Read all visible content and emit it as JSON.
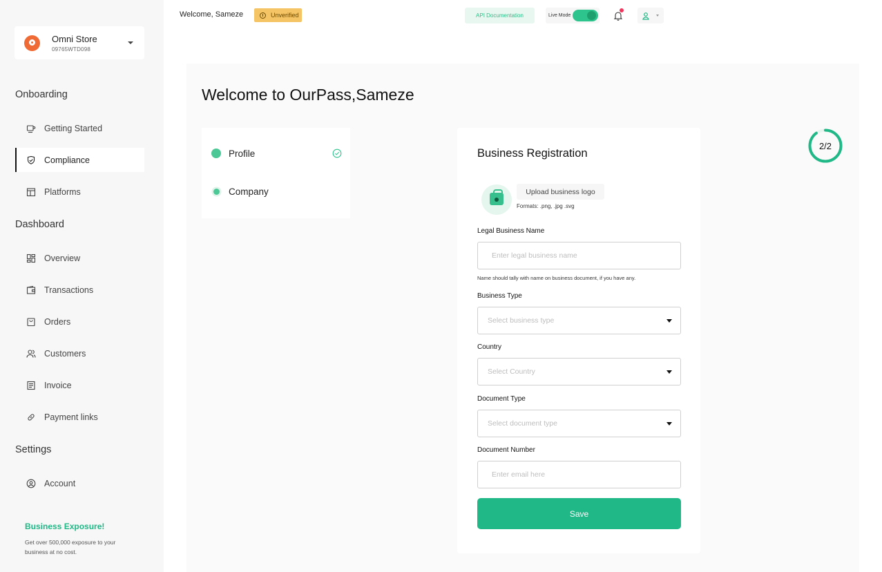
{
  "colors": {
    "accent": "#1fb886",
    "warning": "#f5c465",
    "notification": "#f2345c"
  },
  "store": {
    "name": "Omni Store",
    "id": "09765WTD098"
  },
  "sidebar": {
    "sections": [
      {
        "title": "Onboarding",
        "items": [
          {
            "label": "Getting  Started",
            "icon": "coffee-cup-icon"
          },
          {
            "label": "Compliance",
            "icon": "shield-check-icon",
            "active": true
          },
          {
            "label": "Platforms",
            "icon": "layout-icon"
          }
        ]
      },
      {
        "title": "Dashboard",
        "items": [
          {
            "label": "Overview",
            "icon": "grid-icon"
          },
          {
            "label": "Transactions",
            "icon": "wallet-icon"
          },
          {
            "label": "Orders",
            "icon": "shopping-bag-icon"
          },
          {
            "label": "Customers",
            "icon": "users-icon"
          },
          {
            "label": "Invoice",
            "icon": "document-icon"
          },
          {
            "label": "Payment links",
            "icon": "link-icon"
          }
        ]
      },
      {
        "title": "Settings",
        "items": [
          {
            "label": "Account",
            "icon": "user-circle-icon"
          }
        ]
      }
    ],
    "promo": {
      "title": "Business Exposure!",
      "text": "Get over 500,000 exposure to your business at no cost."
    }
  },
  "topbar": {
    "welcome": "Welcome, Sameze",
    "status_badge": "Unverified",
    "api_button": "API Documentation",
    "live_mode_label": "Live Mode",
    "live_mode_on": true
  },
  "main": {
    "title": "Welcome to OurPass,Sameze",
    "steps": [
      {
        "label": "Profile",
        "completed": true
      },
      {
        "label": "Company",
        "completed": false
      }
    ],
    "progress": {
      "label": "2/2",
      "fraction": 1.0
    }
  },
  "form": {
    "title": "Business Registration",
    "upload_button": "Upload business logo",
    "upload_formats": "Formats: .png, .jpg .svg",
    "legal_name_label": "Legal Business Name",
    "legal_name_placeholder": "Enter legal business name",
    "legal_name_hint": "Name should tally with name on business document, if you have any.",
    "business_type_label": "Business Type",
    "business_type_placeholder": "Select business type",
    "country_label": "Country",
    "country_placeholder": "Select Country",
    "document_type_label": "Document Type",
    "document_type_placeholder": "Select document type",
    "document_number_label": "Document Number",
    "document_number_placeholder": "Enter email here",
    "save_label": "Save"
  }
}
